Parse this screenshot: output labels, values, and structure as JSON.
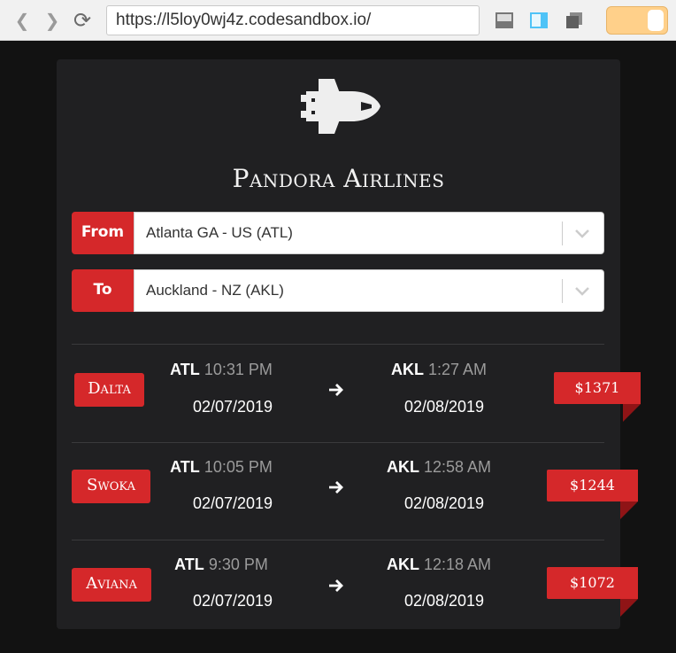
{
  "browser": {
    "url": "https://l5loy0wj4z.codesandbox.io/",
    "back_icon": "chevron-left-icon",
    "forward_icon": "chevron-right-icon",
    "reload_icon": "reload-icon"
  },
  "app": {
    "title": "Pandora Airlines",
    "logo_icon": "space-shuttle-icon"
  },
  "search": {
    "from_label": "From",
    "from_value": "Atlanta GA - US (ATL)",
    "to_label": "To",
    "to_value": "Auckland - NZ (AKL)"
  },
  "flights": [
    {
      "carrier": "Dalta",
      "dep_code": "ATL",
      "dep_time": "10:31 PM",
      "dep_date": "02/07/2019",
      "arr_code": "AKL",
      "arr_time": "1:27 AM",
      "arr_date": "02/08/2019",
      "price": "$1371"
    },
    {
      "carrier": "Swoka",
      "dep_code": "ATL",
      "dep_time": "10:05 PM",
      "dep_date": "02/07/2019",
      "arr_code": "AKL",
      "arr_time": "12:58 AM",
      "arr_date": "02/08/2019",
      "price": "$1244"
    },
    {
      "carrier": "Aviana",
      "dep_code": "ATL",
      "dep_time": "9:30 PM",
      "dep_date": "02/07/2019",
      "arr_code": "AKL",
      "arr_time": "12:18 AM",
      "arr_date": "02/08/2019",
      "price": "$1072"
    }
  ],
  "colors": {
    "accent": "#d5282a",
    "card": "#202022",
    "background": "#121212"
  }
}
